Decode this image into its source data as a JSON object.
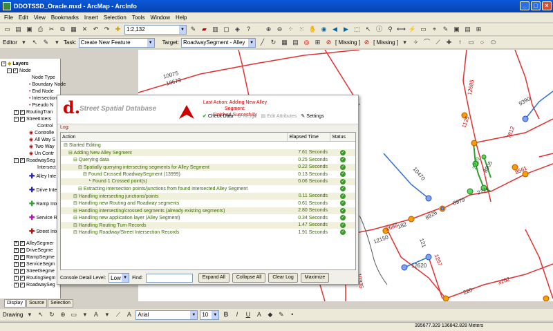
{
  "window": {
    "title": "DDOTSSD_Oracle.mxd - ArcMap - ArcInfo"
  },
  "menu": [
    "File",
    "Edit",
    "View",
    "Bookmarks",
    "Insert",
    "Selection",
    "Tools",
    "Window",
    "Help"
  ],
  "toolbar1": {
    "scale": "1:2,132"
  },
  "editor": {
    "editor_label": "Editor",
    "task_label": "Task:",
    "task_value": "Create New Feature",
    "target_label": "Target:",
    "target_value": "RoadwaySegment - Alley",
    "missing1": "[ Missing ]",
    "missing2": "[ Missing ]"
  },
  "toc": {
    "layers_title": "Layers",
    "items": [
      "Node",
      "Node Type",
      "Boundary Node",
      "End Node",
      "Intersection",
      "Pseudo N",
      "RoutingTran",
      "StreetInters",
      "Control",
      "Controlle",
      "All Way S",
      "Two Way",
      "Un Contr",
      "RoadwaySeg",
      "Intersect",
      "Alley Inte",
      "Drive Inte",
      "Ramp Inte",
      "Service R",
      "Street Inte",
      "AlleySegmer",
      "DriveSegme",
      "RampSegme",
      "ServiceSegm",
      "StreetSegme",
      "RoutingSegm",
      "RoadwaySeg"
    ]
  },
  "toc_tabs": [
    "Display",
    "Source",
    "Selection"
  ],
  "dialog": {
    "logo_letter": "d.",
    "logo_text": "Street Spatial Database",
    "last_action_line1": "Last Action: Adding New Alley Segment:",
    "last_action_line2": "Finished Succesfully",
    "btn_check": "Check Data",
    "btn_merge": "Merge",
    "btn_edit": "Edit Attributes",
    "btn_settings": "Settings",
    "log_label": "Log:",
    "col_action": "Action",
    "col_time": "Elapsed Time",
    "col_status": "Status",
    "rows": [
      {
        "indent": 0,
        "text": "Started Editing",
        "time": ""
      },
      {
        "indent": 1,
        "text": "Adding New Alley Segment",
        "time": "7.61 Seconds"
      },
      {
        "indent": 2,
        "text": "Querying data",
        "time": "0.25 Seconds"
      },
      {
        "indent": 3,
        "text": "Spatially querying intersecting segments for Alley Segment",
        "time": "0.22 Seconds"
      },
      {
        "indent": 4,
        "text": "Found Crossed RoadwaySegment (13999)",
        "time": "0.13 Seconds"
      },
      {
        "indent": 5,
        "text": "Found 1 Crossed point(s)",
        "time": "0.06 Seconds"
      },
      {
        "indent": 3,
        "text": "Extracting intersection points/junctions from found intersected Alley Segment",
        "time": ""
      },
      {
        "indent": 2,
        "text": "Handling intersecting junctions/points",
        "time": "0.11 Seconds"
      },
      {
        "indent": 2,
        "text": "Handling new Routing and Roadway segments",
        "time": "0.61 Seconds"
      },
      {
        "indent": 2,
        "text": "Handling intersecting/crossed segments (already existing segments)",
        "time": "2.80 Seconds"
      },
      {
        "indent": 2,
        "text": "Handling new application layer (Alley Segment)",
        "time": "0.34 Seconds"
      },
      {
        "indent": 2,
        "text": "Handling Routing Turn Records",
        "time": "1.47 Seconds"
      },
      {
        "indent": 2,
        "text": "Handling Roadway/Street Intersection Records",
        "time": "1.91 Seconds"
      }
    ],
    "console_label": "Console Detail Level:",
    "console_value": "Low",
    "find_label": "Find:",
    "btn_expand": "Expand All",
    "btn_collapse": "Collapse All",
    "btn_clear": "Clear Log",
    "btn_maximize": "Maximize"
  },
  "drawing": {
    "label": "Drawing",
    "font": "Arial",
    "size": "10"
  },
  "status": {
    "coords": "395677.329  136842.828 Meters"
  },
  "map_labels": [
    "10075",
    "10673",
    "10670",
    "10470",
    "12685",
    "1125",
    "8905",
    "8890",
    "8882",
    "12689",
    "9390",
    "10130",
    "8561",
    "7812",
    "2686",
    "2220",
    "8926",
    "8979",
    "2771",
    "8970",
    "12670",
    "2686",
    "182",
    "12621",
    "12620",
    "121",
    "1257",
    "10335",
    "4212",
    "2185",
    "2183",
    "11222",
    "12221",
    "12690",
    "13293",
    "1301",
    "1311",
    "2071",
    "10590",
    "7150",
    "12150",
    "21861",
    "2166",
    "1100",
    "220",
    "3202"
  ]
}
